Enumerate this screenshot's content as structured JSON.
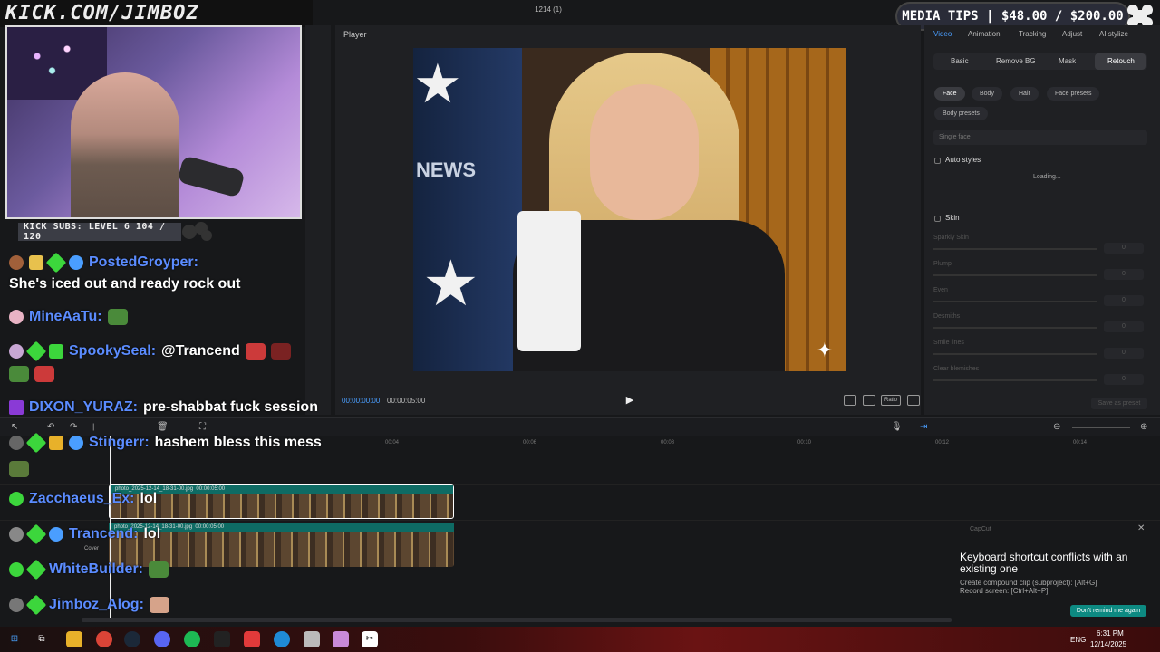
{
  "overlay": {
    "banner_text": "KICK.COM/JIMBOZ",
    "window_title": "1214 (1)",
    "tips_text": "MEDIA TIPS | $48.00 / $200.00",
    "subs_text": "KICK SUBS: LEVEL 6 104 / 120"
  },
  "chat": [
    {
      "user": "PostedGroyper:",
      "message": "She's iced out and ready rock out"
    },
    {
      "user": "MineAaTu:",
      "message": ""
    },
    {
      "user": "SpookySeal:",
      "message": "@Trancend"
    },
    {
      "user": "DIXON_YURAZ:",
      "message": "pre-shabbat fuck session"
    },
    {
      "user": "Stingerr:",
      "message": "hashem bless this mess"
    },
    {
      "user": "Zacchaeus_Ex:",
      "message": "lol"
    },
    {
      "user": "Trancend:",
      "message": "lol"
    },
    {
      "user": "WhiteBuilder:",
      "message": ""
    },
    {
      "user": "Jimboz_Alog:",
      "message": ""
    }
  ],
  "player": {
    "label": "Player",
    "time_current": "00:00:00:00",
    "time_total": "00:00:05:00",
    "ratio_label": "Ratio",
    "video_text": "NEWS"
  },
  "right_panel": {
    "tabs": [
      "Video",
      "Animation",
      "Tracking",
      "Adjust",
      "AI stylize"
    ],
    "subtabs": [
      "Basic",
      "Remove BG",
      "Mask",
      "Retouch"
    ],
    "chips": [
      "Face",
      "Body",
      "Hair",
      "Face presets",
      "Body presets"
    ],
    "single_face": "Single face",
    "auto_styles": "Auto styles",
    "loading": "Loading...",
    "skin": "Skin",
    "sliders": [
      "Sparkly Skin",
      "Plump",
      "Even",
      "Desmiths",
      "Smile lines",
      "Clear blemishes"
    ],
    "slider_value": "0",
    "save_preset": "Save as preset"
  },
  "timeline": {
    "ruler": [
      "00:04",
      "00:06",
      "00:08",
      "00:10",
      "00:12",
      "00:14"
    ],
    "clip_name": "photo_2025-12-14_18-31-00.jpg",
    "clip_duration": "00:00:05:00",
    "cover_label": "Cover"
  },
  "toast": {
    "app": "CapCut",
    "title": "Keyboard shortcut conflicts with an existing one",
    "line1": "Create compound clip (subproject): [Alt+G]",
    "line2": "Record screen: [Ctrl+Alt+P]",
    "button": "Don't remind me again"
  },
  "taskbar": {
    "lang": "ENG",
    "time": "6:31 PM",
    "date": "12/14/2025"
  }
}
